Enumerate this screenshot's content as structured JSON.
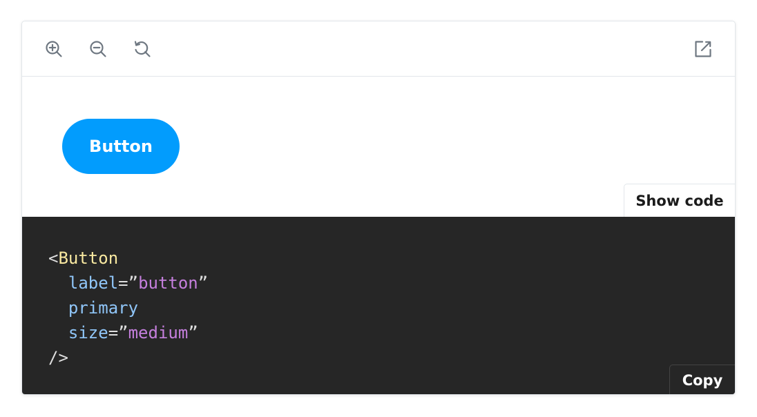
{
  "toolbar": {
    "tools": [
      {
        "name": "zoom-in",
        "icon": "zoom-in-icon"
      },
      {
        "name": "zoom-out",
        "icon": "zoom-out-icon"
      },
      {
        "name": "reset-zoom",
        "icon": "reset-zoom-icon"
      }
    ],
    "open_in_new_tab": {
      "icon": "external-link-icon"
    },
    "icon_color": "#6e7781"
  },
  "preview": {
    "button_label": "Button",
    "button_color": "#029cfd",
    "show_code_label": "Show code"
  },
  "code": {
    "lines": [
      {
        "tag_open": "<",
        "tag": "Button"
      },
      {
        "attr": "label",
        "eq": "=",
        "quote_open": "”",
        "value": "button",
        "quote_close": "”"
      },
      {
        "attr": "primary"
      },
      {
        "attr": "size",
        "eq": "=",
        "quote_open": "”",
        "value": "medium",
        "quote_close": "”"
      },
      {
        "close": "/>"
      }
    ],
    "copy_label": "Copy",
    "background": "#262626"
  }
}
